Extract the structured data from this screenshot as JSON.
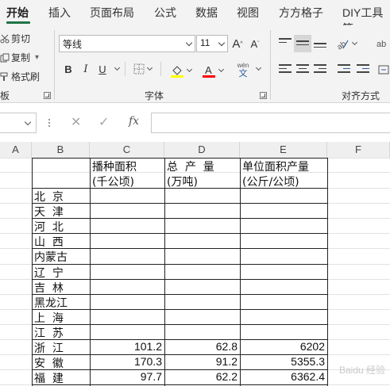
{
  "ribbon_tabs": [
    "开始",
    "插入",
    "页面布局",
    "公式",
    "数据",
    "视图",
    "方方格子",
    "DIY工具箱"
  ],
  "clipboard": {
    "cut": "剪切",
    "copy": "复制",
    "copy_arrow": "▾",
    "format_painter": "格式刷",
    "group_label": "板"
  },
  "font": {
    "name": "等线",
    "size": "11",
    "grow": "A",
    "shrink": "A",
    "bold": "B",
    "italic": "I",
    "underline": "U",
    "phonetic_top": "wén",
    "phonetic_bottom": "文",
    "group_label": "字体",
    "fill_color": "#ffff00",
    "font_color": "#ff0000"
  },
  "alignment": {
    "group_label": "对齐方式"
  },
  "formula_bar": {
    "fx": "fx",
    "cancel": "✕",
    "enter": "✓"
  },
  "columns": [
    "A",
    "B",
    "C",
    "D",
    "E",
    "F"
  ],
  "headers": {
    "c_line1": "播种面积",
    "c_line2": "(千公顷)",
    "d_line1": "总  产  量",
    "d_line2": "(万吨)",
    "e_line1": "单位面积产量",
    "e_line2": "(公斤/公顷)"
  },
  "rows": [
    {
      "region": "北  京",
      "area": "",
      "output": "",
      "yield": ""
    },
    {
      "region": "天  津",
      "area": "",
      "output": "",
      "yield": ""
    },
    {
      "region": "河  北",
      "area": "",
      "output": "",
      "yield": ""
    },
    {
      "region": "山  西",
      "area": "",
      "output": "",
      "yield": ""
    },
    {
      "region": "内蒙古",
      "area": "",
      "output": "",
      "yield": ""
    },
    {
      "region": "辽  宁",
      "area": "",
      "output": "",
      "yield": ""
    },
    {
      "region": "吉  林",
      "area": "",
      "output": "",
      "yield": ""
    },
    {
      "region": "黑龙江",
      "area": "",
      "output": "",
      "yield": ""
    },
    {
      "region": "上  海",
      "area": "",
      "output": "",
      "yield": ""
    },
    {
      "region": "江  苏",
      "area": "",
      "output": "",
      "yield": ""
    },
    {
      "region": "浙  江",
      "area": "101.2",
      "output": "62.8",
      "yield": "6202"
    },
    {
      "region": "安  徽",
      "area": "170.3",
      "output": "91.2",
      "yield": "5355.3"
    },
    {
      "region": "福  建",
      "area": "97.7",
      "output": "62.2",
      "yield": "6362.4"
    }
  ],
  "watermark": "Baidu 经验"
}
